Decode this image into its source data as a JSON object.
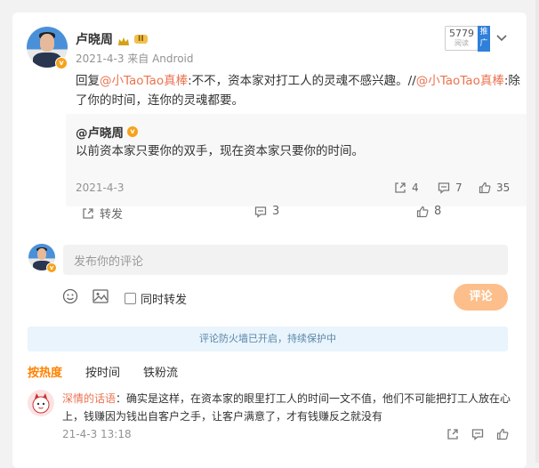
{
  "post": {
    "author": "卢晓周",
    "level_badge": "II",
    "meta": "2021-4-3 来自 Android",
    "read_count": "5779",
    "read_label": "阅读",
    "promote_label": "推广",
    "reply_prefix": "回复",
    "mention1": "@小TaoTao真棒",
    "reply_text": ":不不，资本家对打工人的灵魂不感兴趣。//",
    "mention2": "@小TaoTao真棒",
    "reply_text2": ":除了你的时间，连你的灵魂都要。"
  },
  "quoted": {
    "author": "@卢晓周",
    "text": "以前资本家只要你的双手，现在资本家只要你的时间。",
    "date": "2021-4-3",
    "share_count": "4",
    "comment_count": "7",
    "like_count": "35"
  },
  "actions": {
    "share_label": "转发",
    "comment_count": "3",
    "like_count": "8"
  },
  "composer": {
    "placeholder": "发布你的评论",
    "repost_label": "同时转发",
    "submit_label": "评论"
  },
  "notice": "评论防火墙已开启，持续保护中",
  "tabs": [
    "按热度",
    "按时间",
    "铁粉流"
  ],
  "comment": {
    "author": "深情的话语",
    "text_line1": "：确实是这样，在资本家的眼里打工人的时间一文不值，他们不可能把打工人放在心",
    "text_line2": "上，钱赚因为钱出自客户之手，让客户满意了，才有钱赚反之就没有",
    "time": "21-4-3 13:18"
  },
  "colors": {
    "link": "#eb7350",
    "accent": "#ff8200",
    "submit_bg": "#fcbf8c",
    "notice_bg": "#e9f4fc",
    "notice_text": "#5a87a8"
  }
}
